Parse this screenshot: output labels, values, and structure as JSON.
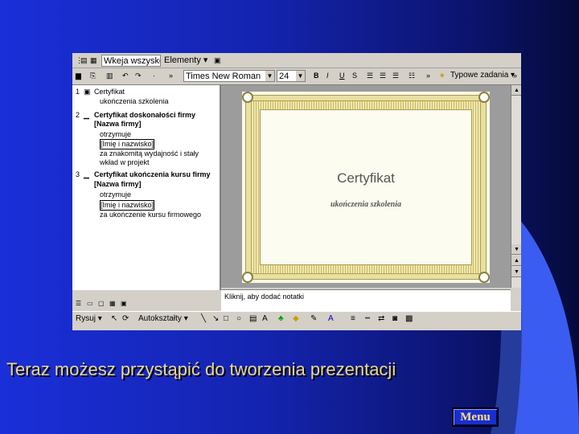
{
  "toolbar_top": {
    "view_label": "Wkeja wszysko",
    "elements_label": "Elementy"
  },
  "toolbar_format": {
    "font": "Times New Roman",
    "size": "24",
    "bold": "B",
    "italic": "I",
    "underline": "U",
    "shadow": "S",
    "tasks": "Typowe zadania"
  },
  "outline": {
    "items": [
      {
        "num": "1",
        "title": "Certyfikat",
        "sub": "ukończenia szkolenia"
      },
      {
        "num": "2",
        "title": "Certyfikat doskonałości firmy",
        "company": "[Nazwa firmy]",
        "lines": [
          "otrzymuje",
          "[Imię i nazwisko]",
          "za znakomitą wydajność i stały",
          "wkład w projekt"
        ]
      },
      {
        "num": "3",
        "title": "Certyfikat ukończenia kursu firmy",
        "company": "[Nazwa firmy]",
        "lines": [
          "otrzymuje",
          "[Imię i nazwisko]",
          "za ukończenie kursu firmowego"
        ]
      }
    ]
  },
  "slide": {
    "title": "Certyfikat",
    "subtitle": "ukończenia szkolenia"
  },
  "notes": {
    "placeholder": "Kliknij, aby dodać notatki"
  },
  "drawbar": {
    "draw_label": "Rysuj",
    "autoshapes_label": "Autokształty"
  },
  "caption": "Teraz możesz przystąpić do tworzenia prezentacji",
  "menu_button": "Menu",
  "colors": {
    "background": "#1424b0",
    "caption": "#e8d890",
    "swoosh": "#3a5cf0"
  }
}
